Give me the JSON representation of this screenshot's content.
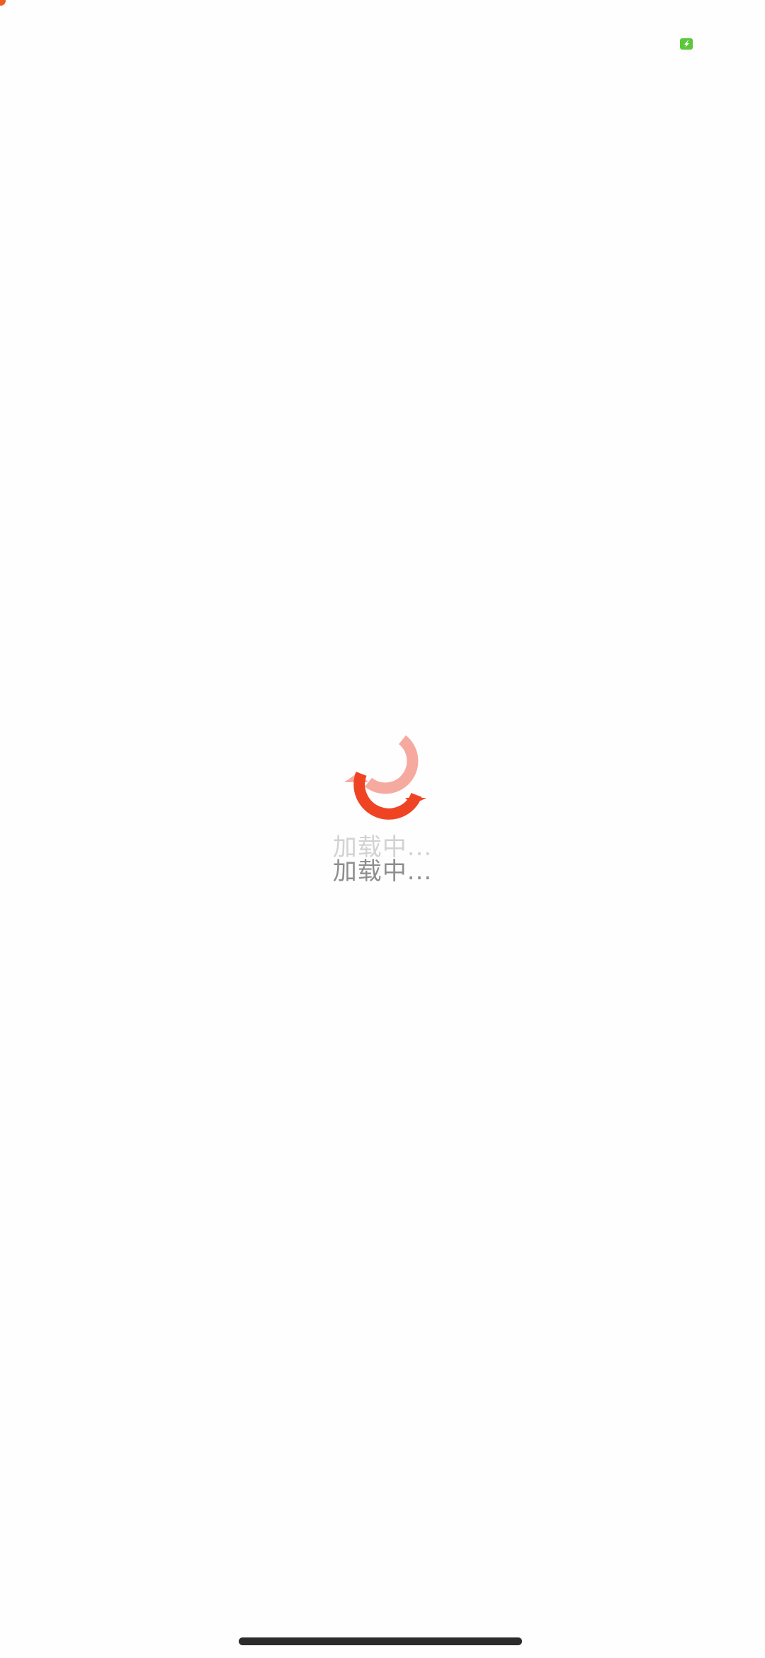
{
  "loading": {
    "text": "加载中...",
    "text_ghost": "加载中..."
  },
  "colors": {
    "spinner_primary": "#ef4423",
    "spinner_faded": "#f6aa9f",
    "text_primary": "#8e8e8e",
    "text_ghost": "#d2d2d2",
    "battery": "#5cc73b",
    "corner_dot": "#f05a24",
    "home_indicator": "#2b2b2b"
  },
  "icons": {
    "spinner": "loading-spinner-icon",
    "battery": "battery-charging-icon"
  }
}
